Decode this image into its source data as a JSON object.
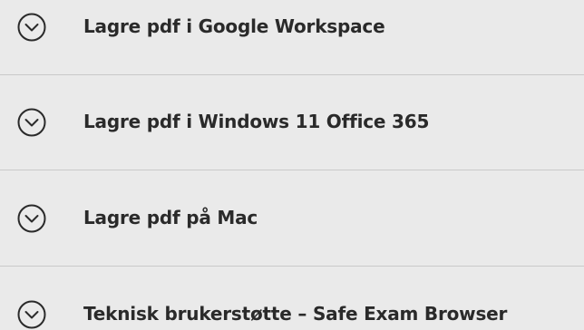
{
  "accordion": {
    "items": [
      {
        "label": "Lagre pdf i Google Workspace",
        "icon": "chevron-down-circle-icon"
      },
      {
        "label": "Lagre pdf i Windows 11 Office 365",
        "icon": "chevron-down-circle-icon"
      },
      {
        "label": "Lagre pdf på Mac",
        "icon": "chevron-down-circle-icon"
      },
      {
        "label": "Teknisk brukerstøtte – Safe Exam Browser",
        "icon": "chevron-down-circle-icon"
      }
    ]
  },
  "colors": {
    "background": "#eaeaea",
    "text": "#2a2a2a",
    "divider": "#c9c9c9"
  }
}
